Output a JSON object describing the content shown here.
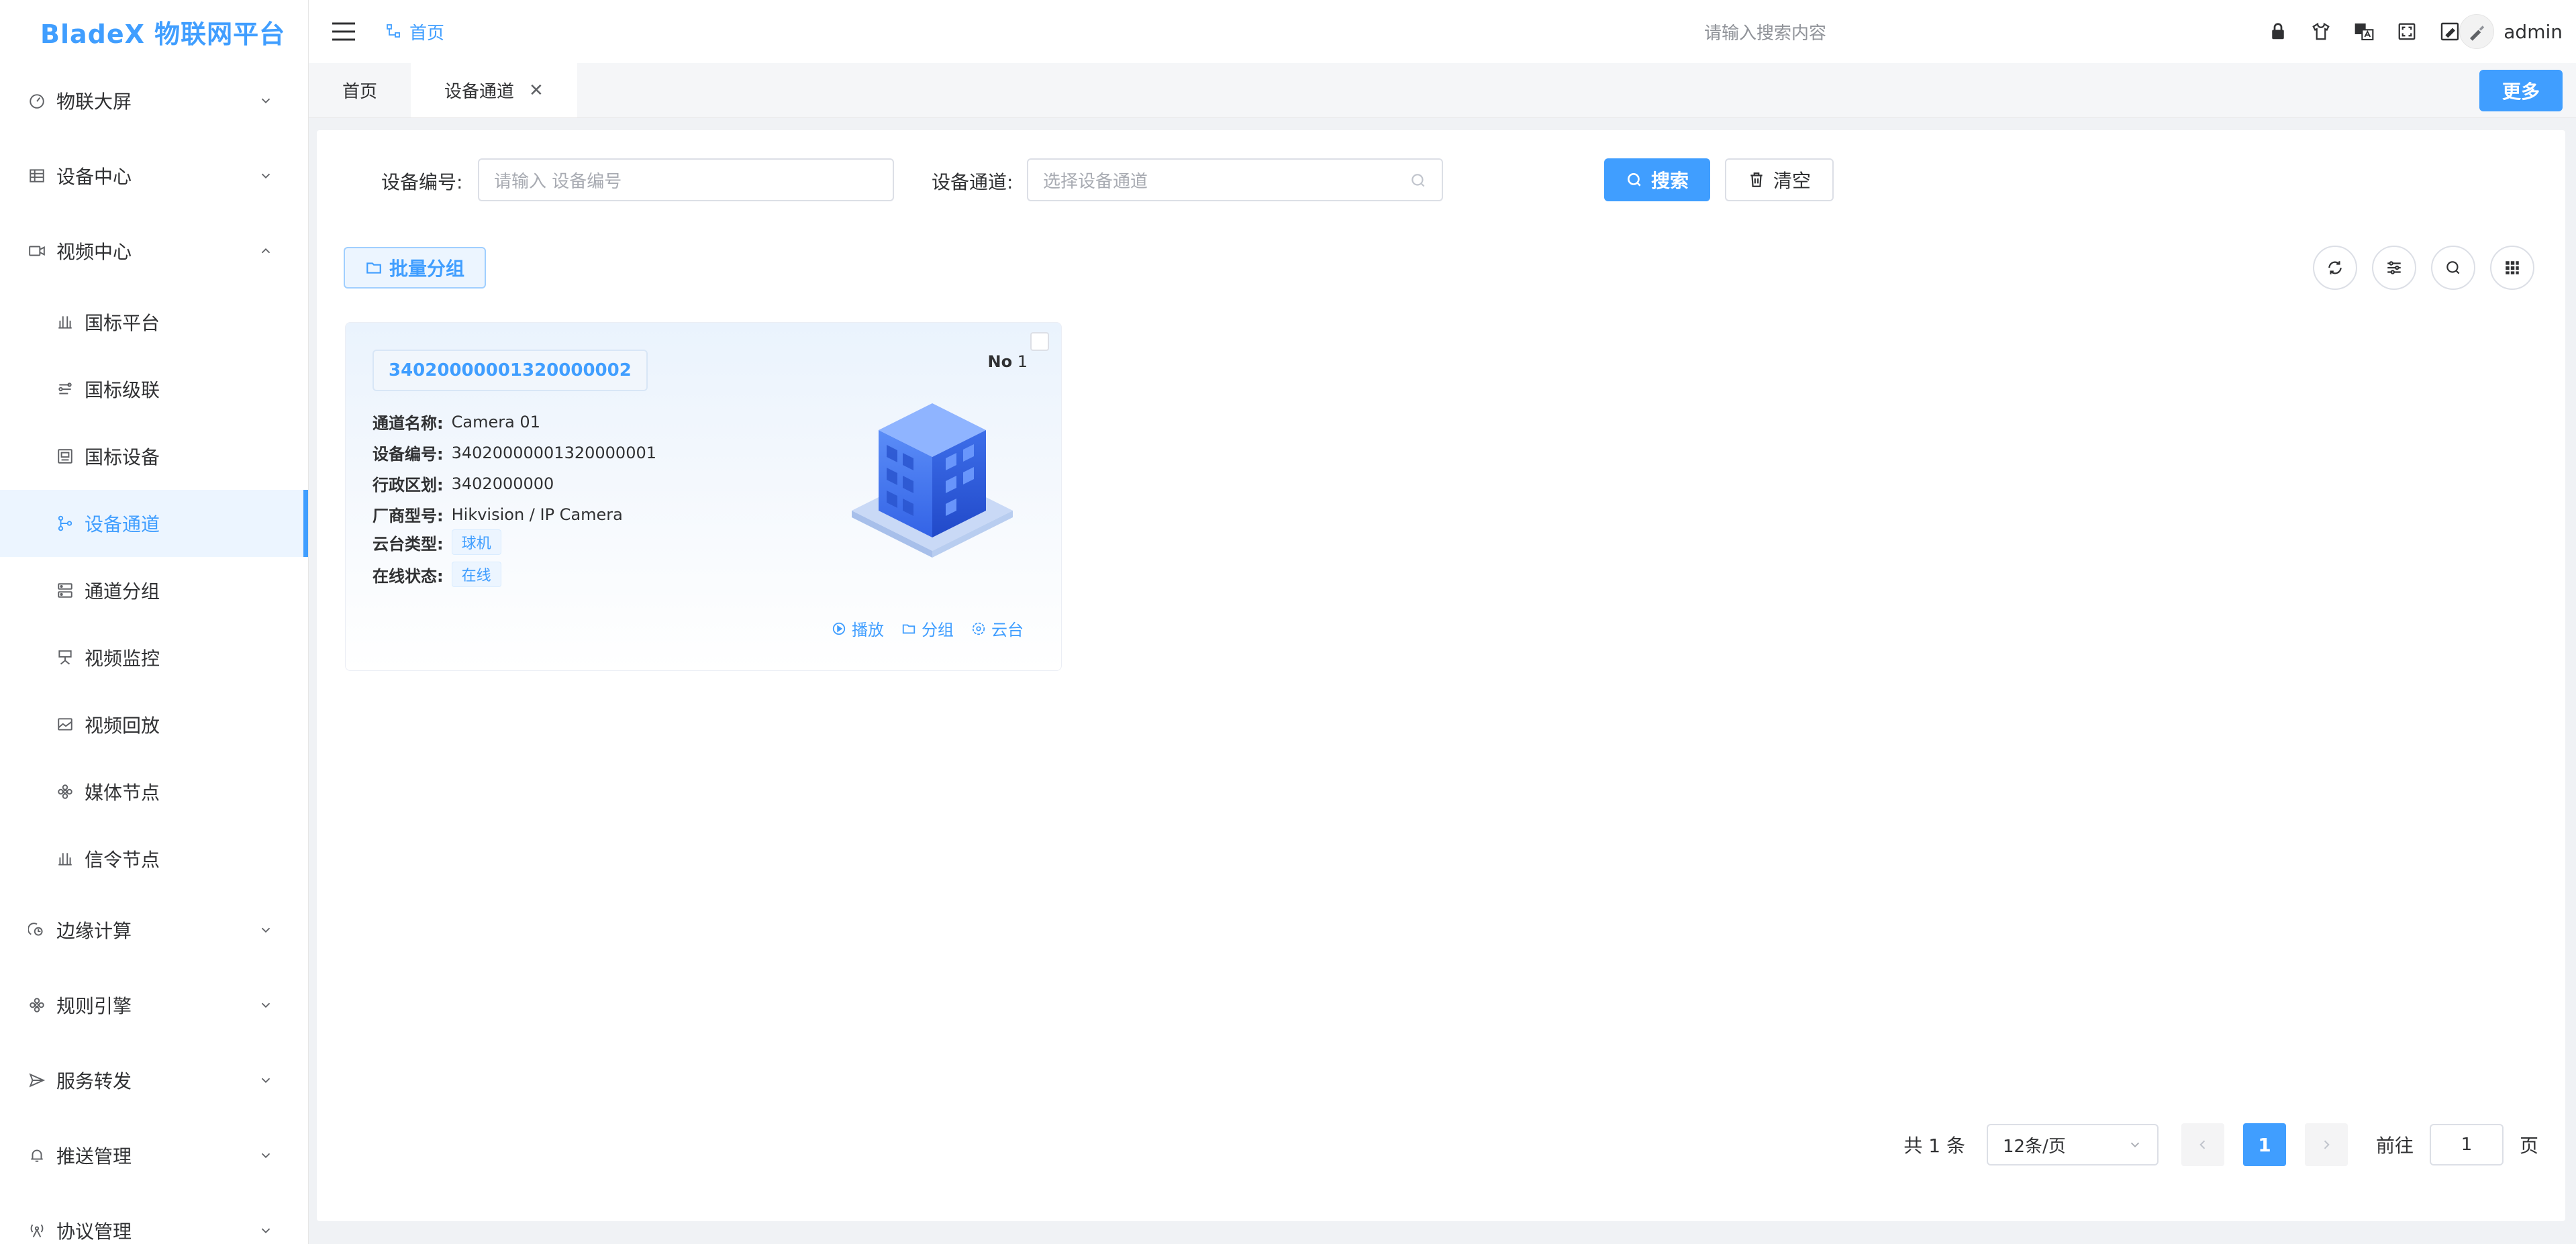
{
  "app": {
    "title": "BladeX 物联网平台"
  },
  "colors": {
    "accent": "#409eff",
    "accent_light": "#ecf5ff",
    "text": "#303133",
    "muted": "#909399"
  },
  "sidebar": {
    "items": [
      {
        "label": "物联大屏",
        "icon": "dashboard-icon",
        "expanded": false
      },
      {
        "label": "设备中心",
        "icon": "table-icon",
        "expanded": false
      },
      {
        "label": "视频中心",
        "icon": "video-icon",
        "expanded": true,
        "children": [
          {
            "label": "国标平台",
            "icon": "platform-icon"
          },
          {
            "label": "国标级联",
            "icon": "cascade-icon"
          },
          {
            "label": "国标设备",
            "icon": "device-icon"
          },
          {
            "label": "设备通道",
            "icon": "branch-icon",
            "active": true
          },
          {
            "label": "通道分组",
            "icon": "server-icon"
          },
          {
            "label": "视频监控",
            "icon": "monitor-icon"
          },
          {
            "label": "视频回放",
            "icon": "playback-icon"
          },
          {
            "label": "媒体节点",
            "icon": "flower-icon"
          },
          {
            "label": "信令节点",
            "icon": "platform-icon"
          }
        ]
      },
      {
        "label": "边缘计算",
        "icon": "edge-icon",
        "expanded": false
      },
      {
        "label": "规则引擎",
        "icon": "flower-icon",
        "expanded": false
      },
      {
        "label": "服务转发",
        "icon": "send-icon",
        "expanded": false
      },
      {
        "label": "推送管理",
        "icon": "bell-icon",
        "expanded": false
      },
      {
        "label": "协议管理",
        "icon": "antenna-icon",
        "expanded": false
      }
    ]
  },
  "header": {
    "breadcrumb": "首页",
    "search_placeholder": "请输入搜索内容",
    "icons": [
      "lock-icon",
      "shirt-icon",
      "translate-icon",
      "fullscreen-icon",
      "image-icon"
    ],
    "username": "admin"
  },
  "tabs": [
    {
      "label": "首页",
      "active": false,
      "closable": false
    },
    {
      "label": "设备通道",
      "active": true,
      "closable": true
    }
  ],
  "more_label": "更多",
  "filters": {
    "device_no_label": "设备编号:",
    "device_no_placeholder": "请输入 设备编号",
    "channel_label": "设备通道:",
    "channel_placeholder": "选择设备通道",
    "search_label": "搜索",
    "clear_label": "清空"
  },
  "batch_group_label": "批量分组",
  "tool_icons": [
    "refresh-icon",
    "filter-settings-icon",
    "search-icon",
    "grid-icon"
  ],
  "card": {
    "id": "34020000001320000002",
    "no_prefix": "No",
    "no": "1",
    "fields": [
      {
        "key": "通道名称:",
        "value": "Camera 01"
      },
      {
        "key": "设备编号:",
        "value": "34020000001320000001"
      },
      {
        "key": "行政区划:",
        "value": "3402000000"
      },
      {
        "key": "厂商型号:",
        "value": "Hikvision / IP Camera"
      }
    ],
    "ptz_key": "云台类型:",
    "ptz_value": "球机",
    "status_key": "在线状态:",
    "status_value": "在线",
    "actions": [
      {
        "label": "播放",
        "icon": "play-icon"
      },
      {
        "label": "分组",
        "icon": "folder-icon"
      },
      {
        "label": "云台",
        "icon": "ptz-icon"
      }
    ]
  },
  "pagination": {
    "total": "共 1 条",
    "page_size": "12条/页",
    "current_page": "1",
    "goto_label": "前往",
    "goto_value": "1",
    "page_suffix": "页"
  }
}
